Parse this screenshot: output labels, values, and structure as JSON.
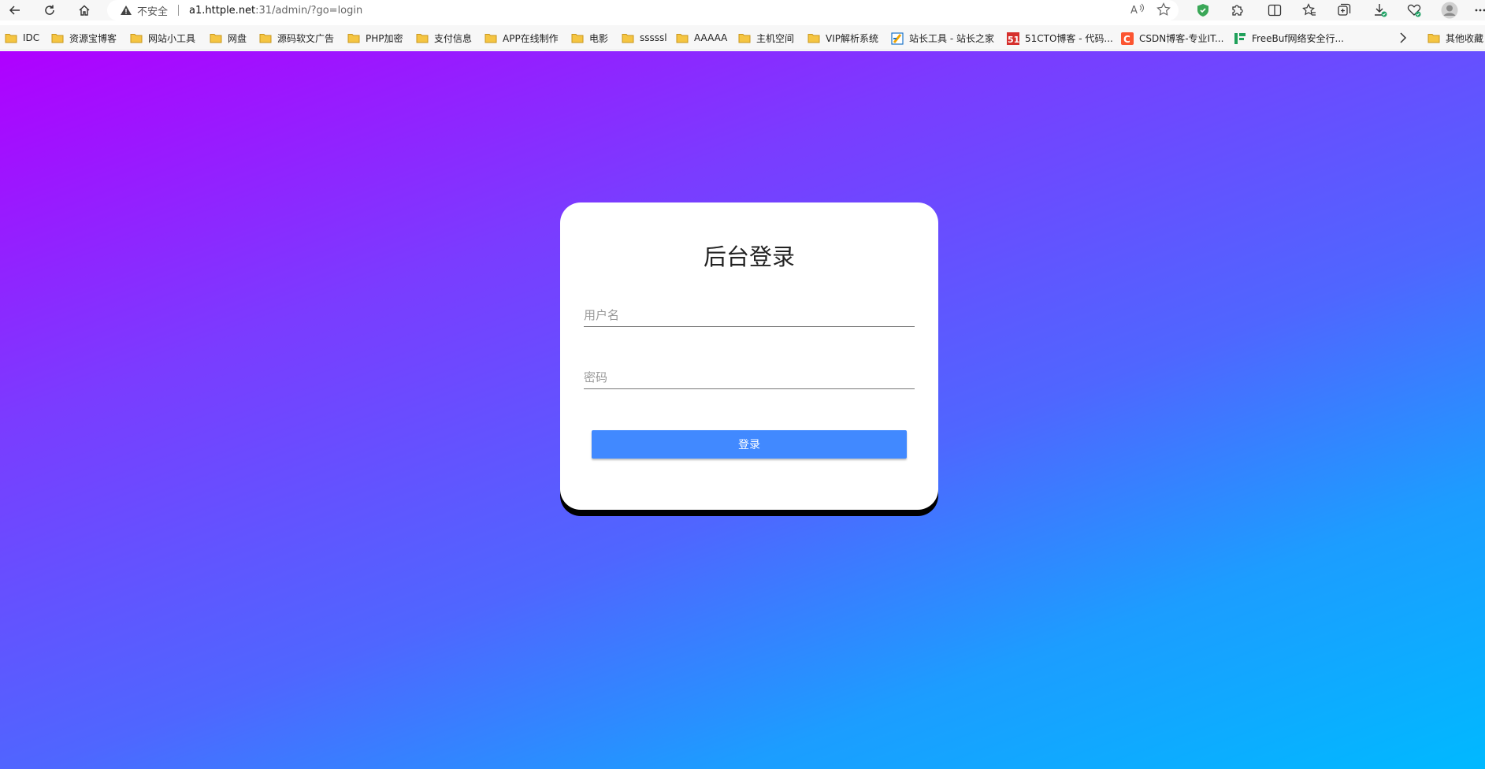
{
  "browser": {
    "insecure_label": "不安全",
    "url_host": "a1.httple.net",
    "url_rest": ":31/admin/?go=login"
  },
  "bookmarks": [
    {
      "label": "IDC",
      "icon": "folder-icon"
    },
    {
      "label": "资源宝博客",
      "icon": "folder-icon"
    },
    {
      "label": "网站小工具",
      "icon": "folder-icon"
    },
    {
      "label": "网盘",
      "icon": "folder-icon"
    },
    {
      "label": "源码软文广告",
      "icon": "folder-icon"
    },
    {
      "label": "PHP加密",
      "icon": "folder-icon"
    },
    {
      "label": "支付信息",
      "icon": "folder-icon"
    },
    {
      "label": "APP在线制作",
      "icon": "folder-icon"
    },
    {
      "label": "电影",
      "icon": "folder-icon"
    },
    {
      "label": "sssssl",
      "icon": "folder-icon"
    },
    {
      "label": "AAAAA",
      "icon": "folder-icon"
    },
    {
      "label": "主机空间",
      "icon": "folder-icon"
    },
    {
      "label": "VIP解析系统",
      "icon": "folder-icon"
    },
    {
      "label": "站长工具 - 站长之家",
      "icon": "chinaz-icon"
    },
    {
      "label": "51CTO博客 - 代码...",
      "icon": "51cto-icon"
    },
    {
      "label": "CSDN博客-专业IT...",
      "icon": "csdn-icon"
    },
    {
      "label": "FreeBuf网络安全行...",
      "icon": "freebuf-icon"
    },
    {
      "label": "其他收藏",
      "icon": "folder-icon"
    }
  ],
  "login": {
    "title": "后台登录",
    "username_placeholder": "用户名",
    "password_placeholder": "密码",
    "submit_label": "登录"
  },
  "colors": {
    "gradient_start": "#b000ff",
    "gradient_end": "#00b9ff",
    "button": "#4189ff"
  }
}
